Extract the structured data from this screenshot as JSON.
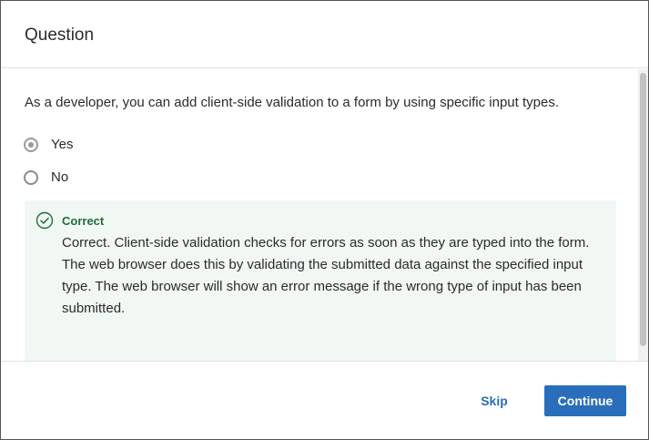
{
  "dialog": {
    "title": "Question"
  },
  "question": {
    "text": "As a developer, you can add client-side validation to a form by using specific input types.",
    "options": [
      {
        "label": "Yes",
        "selected": true
      },
      {
        "label": "No",
        "selected": false
      }
    ]
  },
  "feedback": {
    "status_icon": "check-circle-icon",
    "title": "Correct",
    "text": "Correct. Client-side validation checks for errors as soon as they are typed into the form. The web browser does this by validating the submitted data against the specified input type. The web browser will show an error message if the wrong type of input has been submitted."
  },
  "footer": {
    "skip_label": "Skip",
    "continue_label": "Continue"
  },
  "colors": {
    "accent": "#2a6ebb",
    "success": "#1e6e3a",
    "feedback_bg": "#f1f7f3"
  }
}
